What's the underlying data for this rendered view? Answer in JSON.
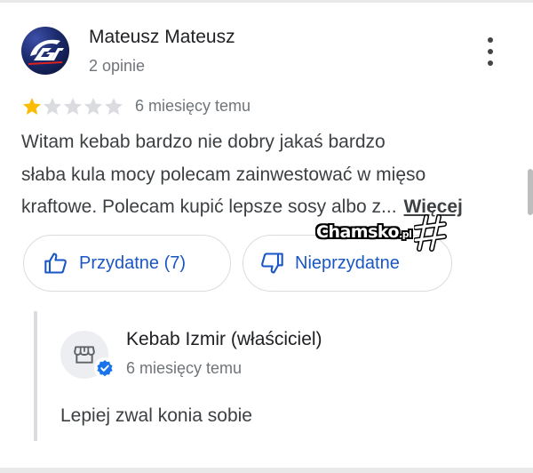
{
  "review": {
    "reviewer_name": "Mateusz Mateusz",
    "reviewer_meta": "2 opinie",
    "rating": 1,
    "rating_max": 5,
    "date": "6 miesięcy temu",
    "text_lines": [
      "Witam kebab bardzo nie dobry jakaś bardzo",
      "słaba kula mocy polecam zainwestować w mięso",
      "kraftowe. Polecam kupić lepsze sosy albo z..."
    ],
    "more_label": "Więcej"
  },
  "actions": {
    "helpful_label": "Przydatne (7)",
    "unhelpful_label": "Nieprzydatne"
  },
  "watermark": {
    "brand": "Chamsko",
    "tld": ".pl"
  },
  "owner_reply": {
    "name": "Kebab Izmir (właściciel)",
    "date": "6 miesięcy temu",
    "text": "Lepiej zwal konia sobie"
  },
  "icons": {
    "more": "more-vert-icon",
    "helpful": "thumb-up-icon",
    "unhelpful": "thumb-down-icon",
    "store": "store-icon",
    "verified": "verified-badge-icon",
    "star": "star-icon"
  },
  "colors": {
    "accent_blue": "#1a56c4",
    "star_filled": "#fbbc04",
    "star_empty": "#dadce0",
    "verified_blue": "#1a73e8"
  }
}
